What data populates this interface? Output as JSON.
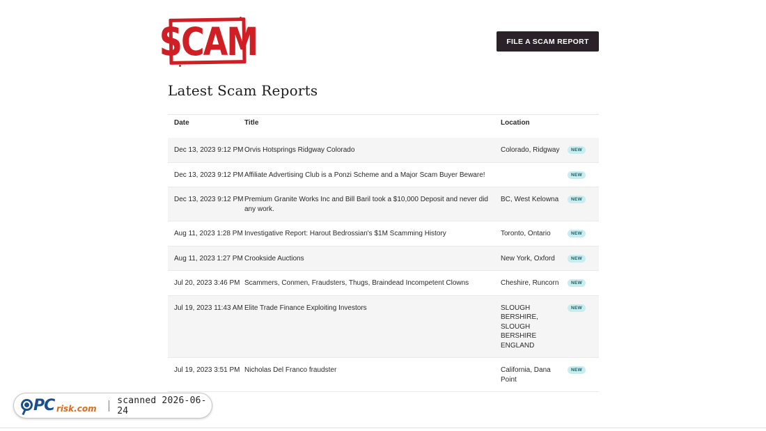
{
  "logo": {
    "text": "SCAM"
  },
  "header": {
    "file_button_label": "FILE A SCAM REPORT"
  },
  "page_title": "Latest Scam Reports",
  "table": {
    "columns": {
      "date": "Date",
      "title": "Title",
      "location": "Location"
    },
    "rows": [
      {
        "date": "Dec 13, 2023 9:12 PM",
        "title": "Orvis Hotsprings Ridgway Colorado",
        "location": "Colorado, Ridgway",
        "badge": "NEW"
      },
      {
        "date": "Dec 13, 2023 9:12 PM",
        "title": "Affiliate Advertising Club is a Ponzi Scheme and a Major Scam Buyer Beware!",
        "location": "",
        "badge": "NEW"
      },
      {
        "date": "Dec 13, 2023 9:12 PM",
        "title": "Premium Granite Works Inc and Bill Baril took a $10,000 Deposit and never did any work.",
        "location": "BC, West Kelowna",
        "badge": "NEW"
      },
      {
        "date": "Aug 11, 2023 1:28 PM",
        "title": "Investigative Report: Harout Bedrossian's $1M Scamming History",
        "location": "Toronto, Ontario",
        "badge": "NEW"
      },
      {
        "date": "Aug 11, 2023 1:27 PM",
        "title": "Crookside Auctions",
        "location": "New York, Oxford",
        "badge": "NEW"
      },
      {
        "date": "Jul 20, 2023 3:46 PM",
        "title": "Scammers, Conmen, Fraudsters, Thugs, Braindead Incompetent Clowns",
        "location": "Cheshire, Runcorn",
        "badge": "NEW"
      },
      {
        "date": "Jul 19, 2023 11:43 AM",
        "title": "Elite Trade Finance Exploiting Investors",
        "location": "SLOUGH BERSHIRE, SLOUGH BERSHIRE ENGLAND",
        "badge": "NEW"
      },
      {
        "date": "Jul 19, 2023 3:51 PM",
        "title": "Nicholas Del Franco fraudster",
        "location": "California, Dana Point",
        "badge": "NEW"
      }
    ]
  },
  "watermark": {
    "brand_pc": "PC",
    "brand_risk": "risk.com",
    "scan_text": "scanned 2026-06-24"
  },
  "colors": {
    "brand_red": "#cf1f24",
    "button_dark": "#2a2228",
    "badge_bg": "#c9ecef",
    "pcrisk_blue": "#1c4f8a",
    "pcrisk_orange": "#e06a1b"
  },
  "icons": {
    "watermark_logo": "magnifier-icon"
  }
}
